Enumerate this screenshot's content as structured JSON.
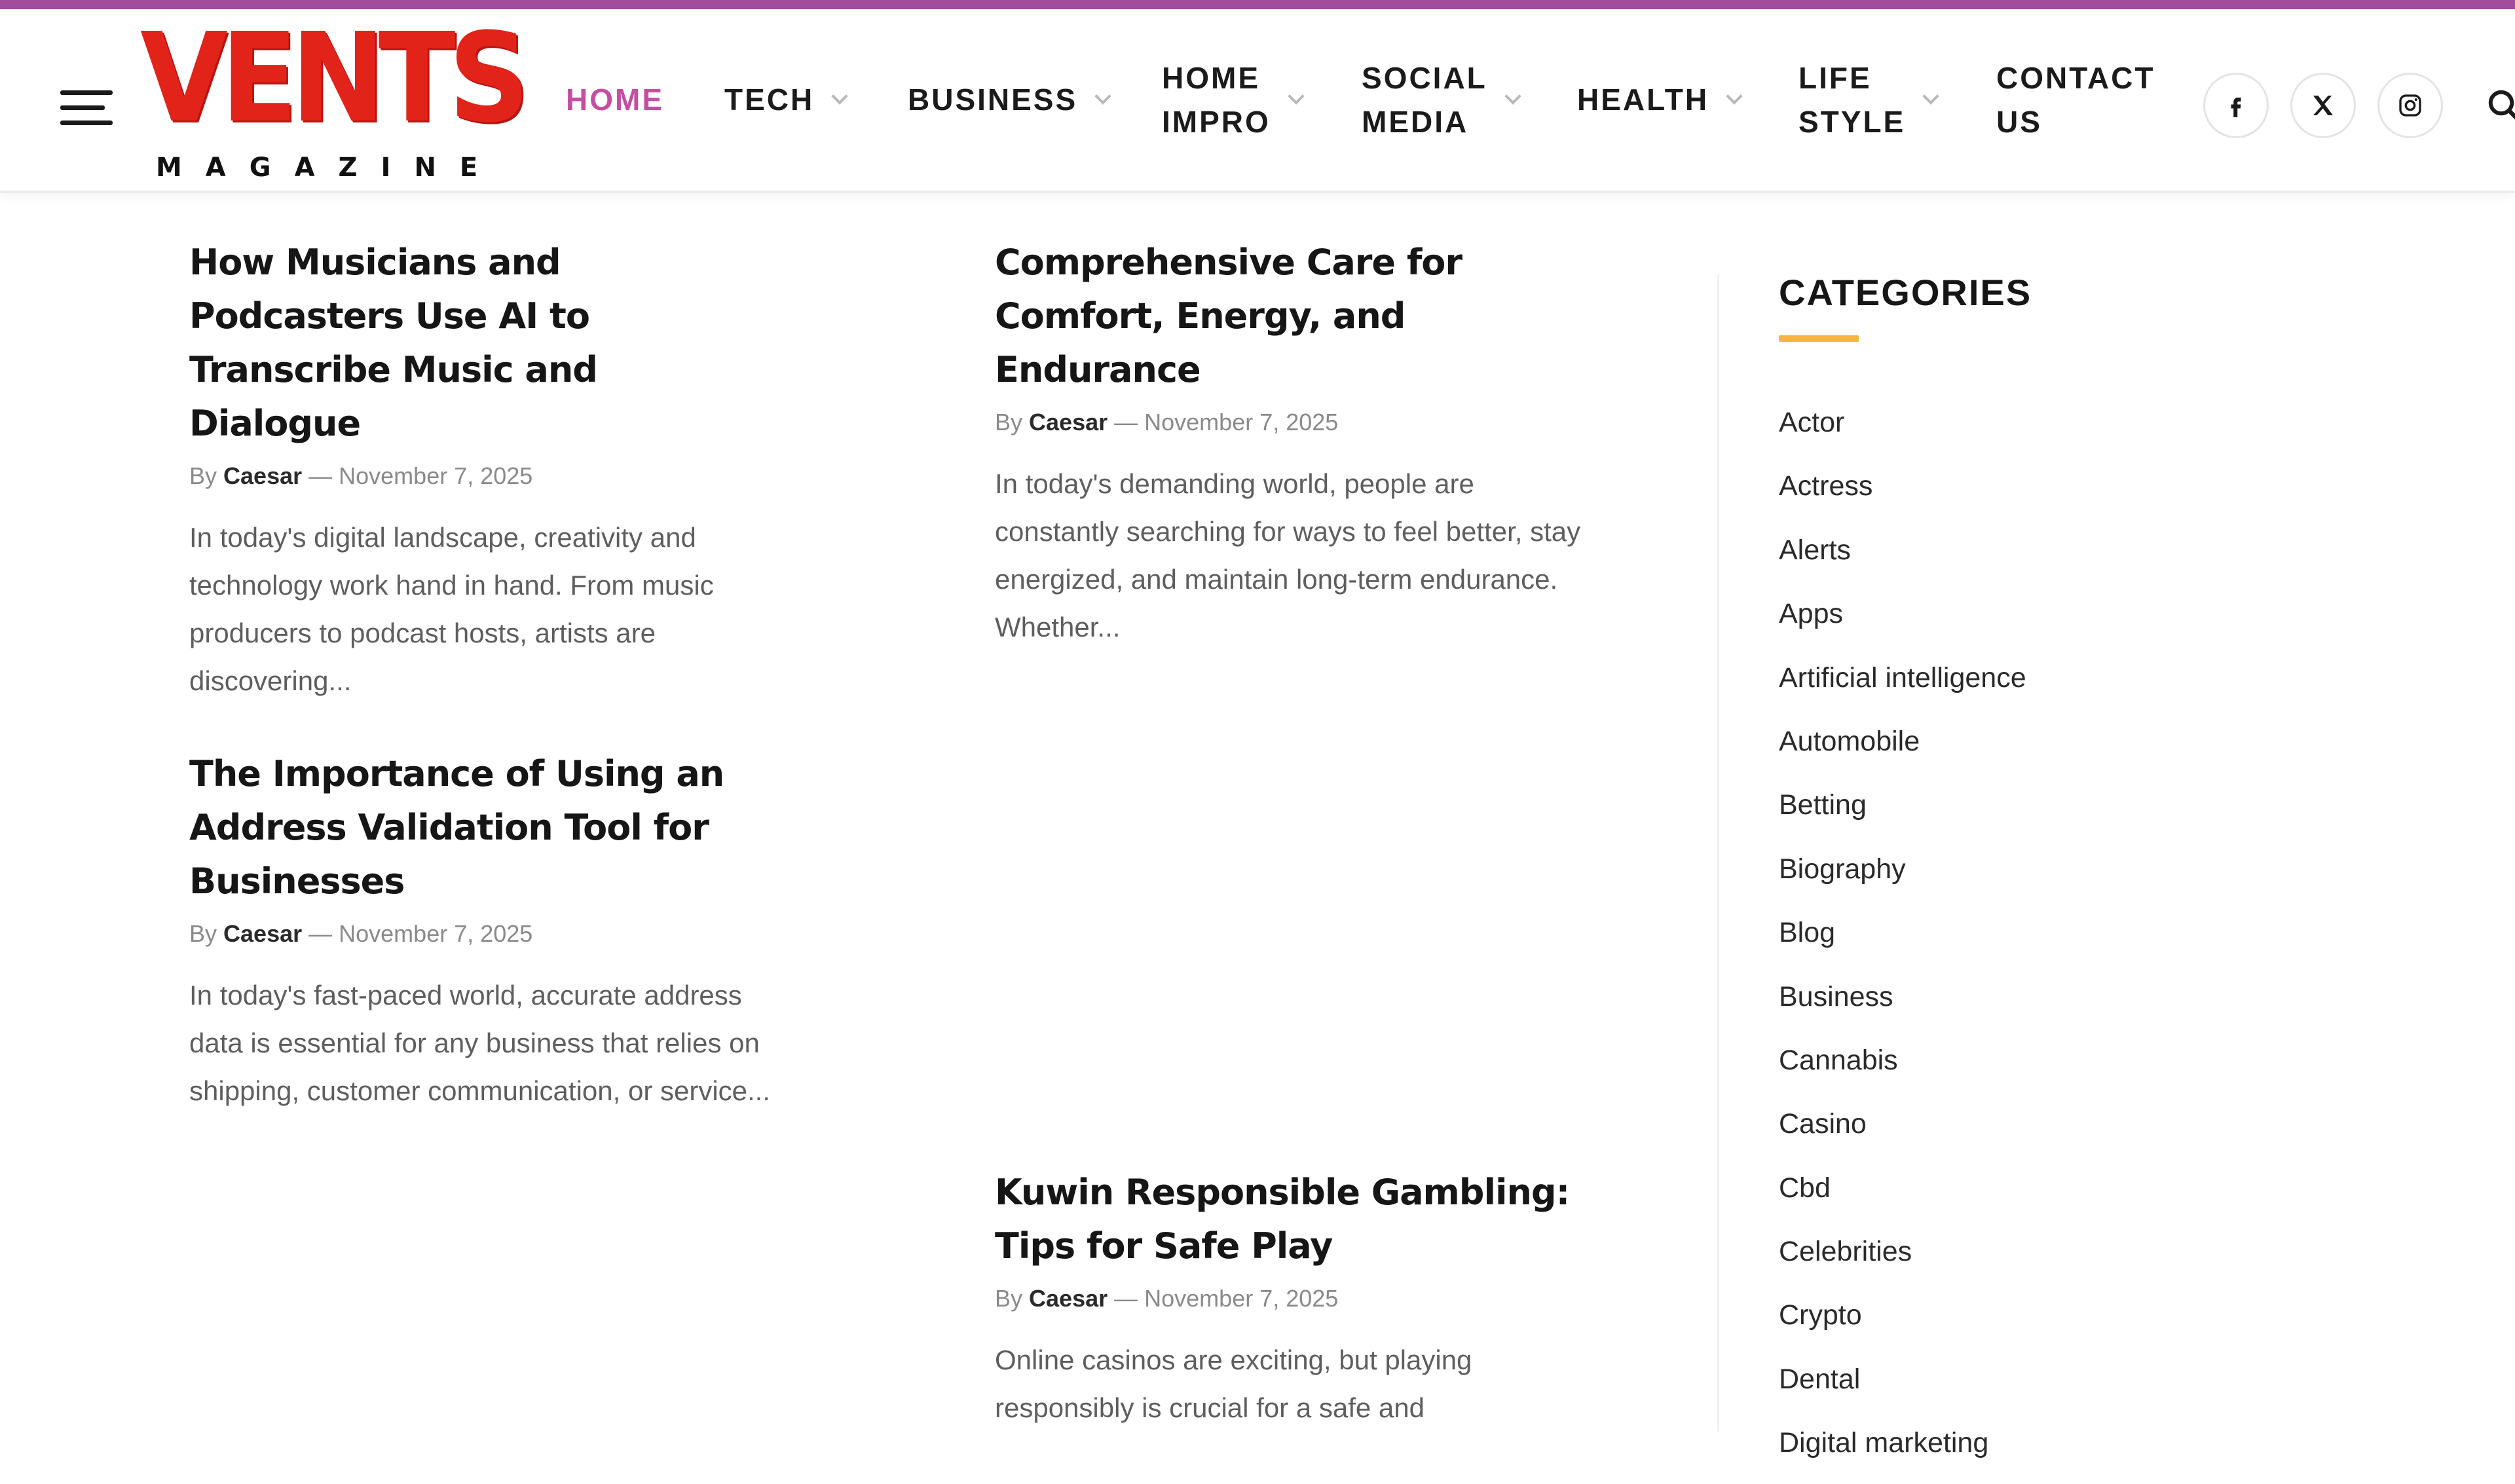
{
  "brand": {
    "name": "VENTS",
    "tagline": "MAGAZINE",
    "accent_color": "#a14c9d",
    "active_nav_color": "#c44fa0",
    "logo_red": "#e2231a",
    "category_underline": "#f4b63f"
  },
  "header": {
    "menu_icon": "hamburger-menu-icon",
    "nav": [
      {
        "label": "HOME",
        "active": true,
        "dropdown": false
      },
      {
        "label": "TECH",
        "active": false,
        "dropdown": true
      },
      {
        "label": "BUSINESS",
        "active": false,
        "dropdown": true
      },
      {
        "label": "HOME\nIMPRO",
        "active": false,
        "dropdown": true
      },
      {
        "label": "SOCIAL\nMEDIA",
        "active": false,
        "dropdown": true
      },
      {
        "label": "HEALTH",
        "active": false,
        "dropdown": true
      },
      {
        "label": "LIFE\nSTYLE",
        "active": false,
        "dropdown": true
      },
      {
        "label": "CONTACT\nUS",
        "active": false,
        "dropdown": false
      }
    ],
    "social": [
      "facebook-icon",
      "x-twitter-icon",
      "instagram-icon"
    ],
    "search_icon": "search-icon"
  },
  "posts": [
    {
      "title": "How Musicians and Podcasters Use AI to Transcribe Music and Dialogue",
      "by": "By",
      "author": "Caesar",
      "date": "— November 7, 2025",
      "excerpt": "In today's digital landscape, creativity and technology work hand in hand. From music producers to podcast hosts, artists are discovering..."
    },
    {
      "title": "The Importance of Using an Address Validation Tool for Businesses",
      "by": "By",
      "author": "Caesar",
      "date": "— November 7, 2025",
      "excerpt": "In today's fast-paced world, accurate address data is essential for any business that relies on shipping, customer communication, or service..."
    },
    {
      "title": "Comprehensive Care for Comfort, Energy, and Endurance",
      "by": "By",
      "author": "Caesar",
      "date": "— November 7, 2025",
      "excerpt": "In today's demanding world, people are constantly searching for ways to feel better, stay energized, and maintain long-term endurance. Whether..."
    },
    {
      "title": "Kuwin Responsible Gambling: Tips for Safe Play",
      "by": "By",
      "author": "Caesar",
      "date": "— November 7, 2025",
      "excerpt": "Online casinos are exciting, but playing responsibly is crucial for a safe and"
    }
  ],
  "sidebar": {
    "heading": "CATEGORIES",
    "categories": [
      "Actor",
      "Actress",
      "Alerts",
      "Apps",
      "Artificial intelligence",
      "Automobile",
      "Betting",
      "Biography",
      "Blog",
      "Business",
      "Cannabis",
      "Casino",
      "Cbd",
      "Celebrities",
      "Crypto",
      "Dental",
      "Digital marketing"
    ]
  }
}
